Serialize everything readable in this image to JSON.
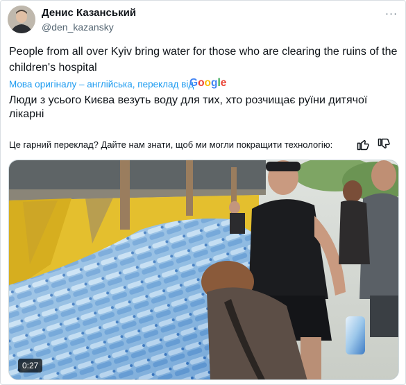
{
  "author": {
    "display_name": "Денис Казанський",
    "handle": "@den_kazansky",
    "avatar_icon": "avatar-photo"
  },
  "tweet": {
    "text": "People from all over Kyiv bring water for those who are clearing the ruins of the children's hospital",
    "translation_note": "Мова оригіналу – англійська, переклад від",
    "translation_brand": [
      "G",
      "o",
      "o",
      "g",
      "l",
      "e"
    ],
    "translated_text": "Люди з усього Києва везуть воду для тих, хто розчищає руїни дитячої лікарні",
    "feedback_prompt": "Це гарний переклад? Дайте нам знати, щоб ми могли покращити технологію:"
  },
  "media": {
    "duration": "0:27",
    "type": "video"
  },
  "colors": {
    "link": "#1d9bf0",
    "text": "#0f1419",
    "secondary": "#536471"
  }
}
